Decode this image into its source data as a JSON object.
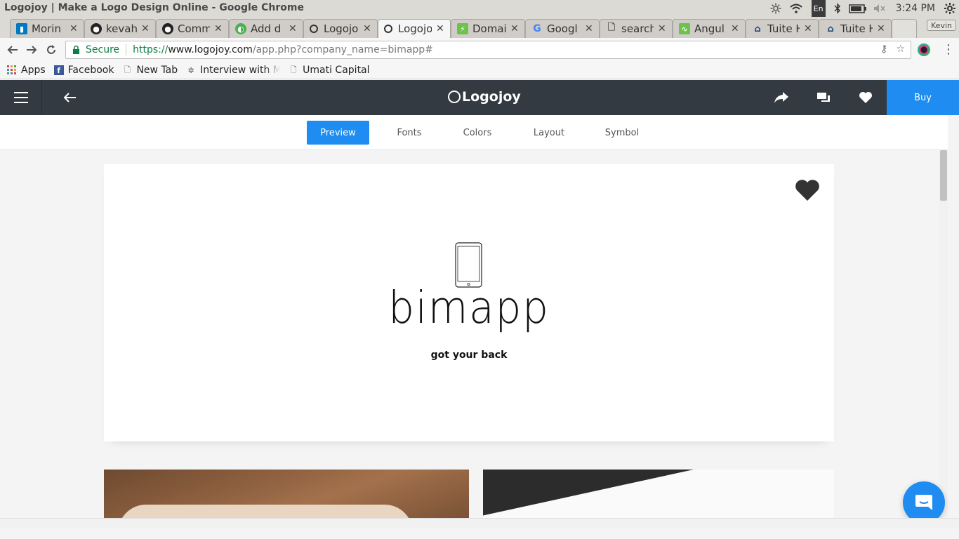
{
  "window": {
    "title": "Logojoy | Make a Logo Design Online - Google Chrome"
  },
  "tray": {
    "lang": "En",
    "clock": "3:24 PM"
  },
  "tabs": [
    {
      "label": "Morin",
      "icon": "trello-icon"
    },
    {
      "label": "kevah",
      "icon": "github-icon"
    },
    {
      "label": "Comm",
      "icon": "github-icon"
    },
    {
      "label": "Add d",
      "icon": "chrome-store-icon"
    },
    {
      "label": "Logojo",
      "icon": "logojoy-icon"
    },
    {
      "label": "Logojo",
      "icon": "logojoy-icon",
      "active": true
    },
    {
      "label": "Domai",
      "icon": "bolt-icon"
    },
    {
      "label": "Googl",
      "icon": "google-icon"
    },
    {
      "label": "search",
      "icon": "page-icon"
    },
    {
      "label": "Angul",
      "icon": "angular-icon"
    },
    {
      "label": "Tuite H",
      "icon": "tuite-icon"
    },
    {
      "label": "Tuite H",
      "icon": "tuite-icon"
    }
  ],
  "profile": {
    "name": "Kevin"
  },
  "omnibox": {
    "secure_label": "Secure",
    "scheme": "https://",
    "host": "www.logojoy.com",
    "path": "/app.php?company_name=bimapp#"
  },
  "bookmarks": [
    {
      "label": "Apps",
      "icon": "apps-grid-icon"
    },
    {
      "label": "Facebook",
      "icon": "facebook-icon"
    },
    {
      "label": "New Tab",
      "icon": "page-icon"
    },
    {
      "label": "Interview with M",
      "icon": "tree-icon"
    },
    {
      "label": "Umati Capital",
      "icon": "page-icon"
    }
  ],
  "app": {
    "brand": "Logojoy",
    "buy_label": "Buy",
    "subtabs": [
      {
        "label": "Preview",
        "active": true
      },
      {
        "label": "Fonts"
      },
      {
        "label": "Colors"
      },
      {
        "label": "Layout"
      },
      {
        "label": "Symbol"
      }
    ]
  },
  "logo": {
    "company_name": "bimapp",
    "tagline": "got your back"
  },
  "colors": {
    "topbar": "#333a41",
    "accent": "#1e8cf0",
    "secure_green": "#0b8043"
  }
}
